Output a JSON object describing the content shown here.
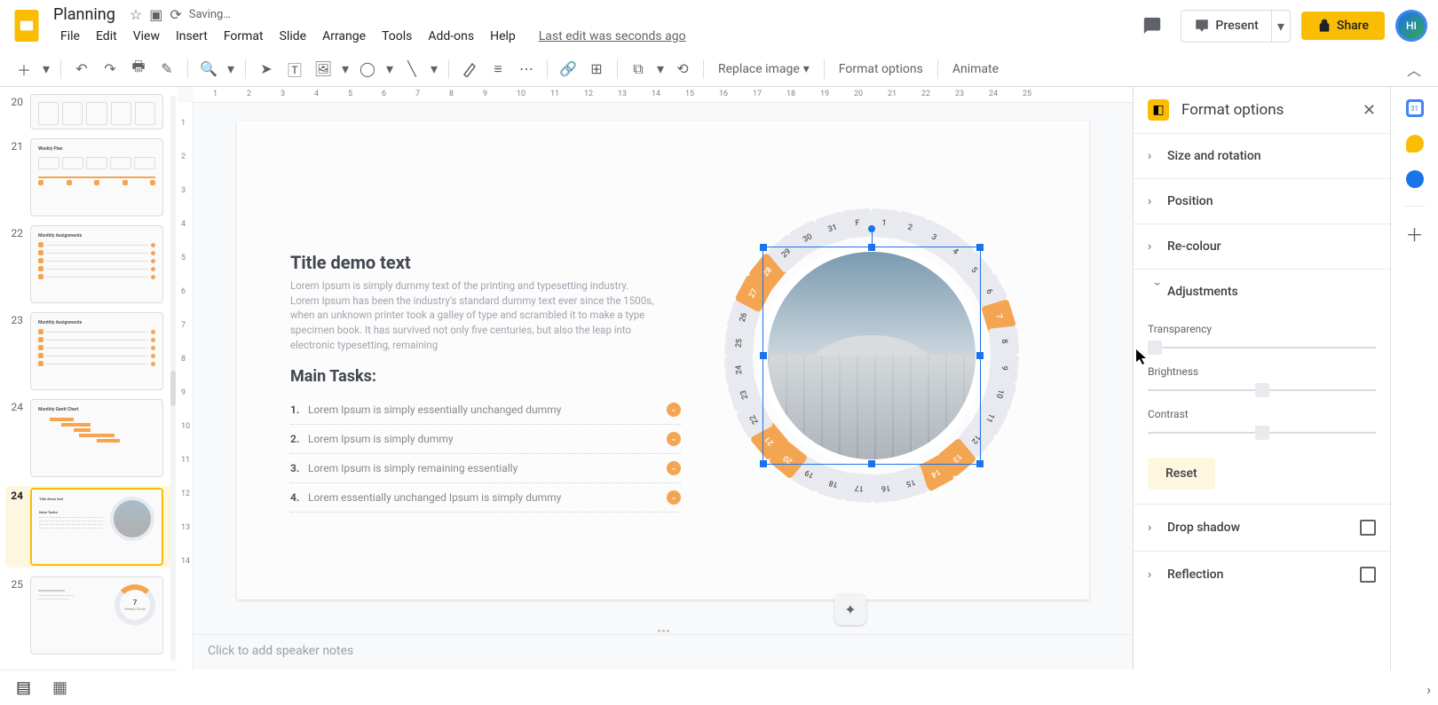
{
  "header": {
    "doc_title": "Planning",
    "save_status": "Saving…",
    "last_edit": "Last edit was seconds ago",
    "present": "Present",
    "share": "Share",
    "avatar_initials": "HI"
  },
  "menu": {
    "file": "File",
    "edit": "Edit",
    "view": "View",
    "insert": "Insert",
    "format": "Format",
    "slide": "Slide",
    "arrange": "Arrange",
    "tools": "Tools",
    "addons": "Add-ons",
    "help": "Help"
  },
  "toolbar": {
    "replace_image": "Replace image",
    "format_options": "Format options",
    "animate": "Animate"
  },
  "thumbs": {
    "nums": [
      "20",
      "21",
      "22",
      "23",
      "24",
      "25"
    ],
    "selected_index": 4,
    "t20_title": "Weekly Plan",
    "t21_title": "Monthly Assignments",
    "t22_title": "Monthly Assignments",
    "t23_title": "Monthly Gantt Chart",
    "t25_center": "7",
    "t25_label": "Weekly Circle"
  },
  "slide": {
    "title": "Title demo text",
    "body": "Lorem Ipsum is simply dummy text of the printing and typesetting industry. Lorem Ipsum has been the industry's standard dummy text ever since the 1500s, when an unknown printer took a galley of type and scrambled it to make a type specimen book. It has survived not only five centuries, but also the leap into electronic typesetting, remaining",
    "subtitle": "Main Tasks:",
    "tasks": [
      {
        "n": "1.",
        "t": "Lorem Ipsum is simply essentially unchanged dummy"
      },
      {
        "n": "2.",
        "t": "Lorem Ipsum is simply dummy"
      },
      {
        "n": "3.",
        "t": "Lorem Ipsum is simply remaining essentially"
      },
      {
        "n": "4.",
        "t": "Lorem essentially unchanged  Ipsum is simply dummy"
      }
    ],
    "ring_header": "F",
    "days": [
      "1",
      "2",
      "3",
      "4",
      "5",
      "6",
      "7",
      "8",
      "9",
      "10",
      "11",
      "12",
      "13",
      "14",
      "15",
      "16",
      "17",
      "18",
      "19",
      "20",
      "21",
      "22",
      "23",
      "24",
      "25",
      "26",
      "27",
      "28",
      "29",
      "30",
      "31"
    ],
    "orange_days": [
      "7",
      "13",
      "14",
      "20",
      "21",
      "27",
      "28"
    ]
  },
  "ruler_h": [
    "1",
    "2",
    "3",
    "4",
    "5",
    "6",
    "7",
    "8",
    "9",
    "10",
    "11",
    "12",
    "13",
    "14",
    "15",
    "16",
    "17",
    "18",
    "19",
    "20",
    "21",
    "22",
    "23",
    "24",
    "25"
  ],
  "ruler_v": [
    "1",
    "2",
    "3",
    "4",
    "5",
    "6",
    "7",
    "8",
    "9",
    "10",
    "11",
    "12",
    "13",
    "14"
  ],
  "notes_placeholder": "Click to add speaker notes",
  "format_panel": {
    "title": "Format options",
    "size_rotation": "Size and rotation",
    "position": "Position",
    "recolour": "Re-colour",
    "adjustments": "Adjustments",
    "transparency": "Transparency",
    "brightness": "Brightness",
    "contrast": "Contrast",
    "reset": "Reset",
    "drop_shadow": "Drop shadow",
    "reflection": "Reflection"
  }
}
